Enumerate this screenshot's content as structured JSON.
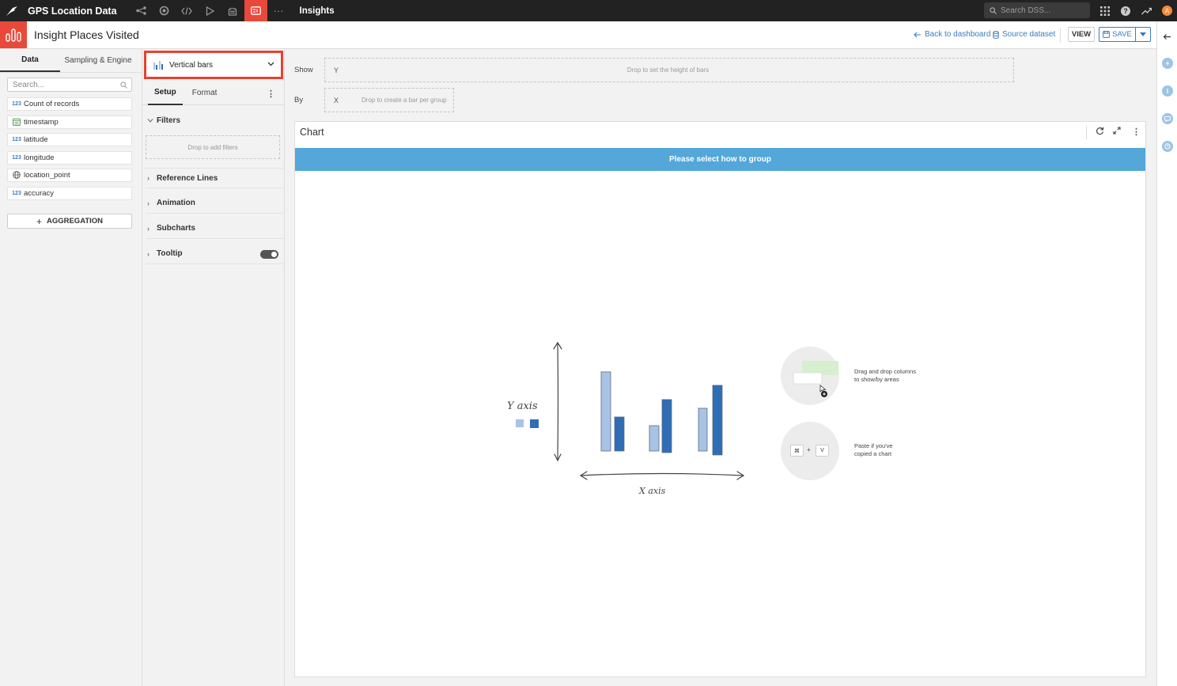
{
  "topbar": {
    "project": "GPS Location Data",
    "section": "Insights",
    "search_placeholder": "Search DSS..."
  },
  "header": {
    "title": "Insight Places Visited",
    "back_link": "Back to dashboard",
    "source_link": "Source dataset",
    "view_label": "VIEW",
    "save_label": "SAVE"
  },
  "left_panel": {
    "tabs": [
      "Data",
      "Sampling & Engine"
    ],
    "search_placeholder": "Search...",
    "columns": [
      {
        "type_icon": "123",
        "name": "Count of records"
      },
      {
        "type_icon": "calendar-icon",
        "name": "timestamp"
      },
      {
        "type_icon": "123",
        "name": "latitude"
      },
      {
        "type_icon": "123",
        "name": "longitude"
      },
      {
        "type_icon": "globe-icon",
        "name": "location_point"
      },
      {
        "type_icon": "123",
        "name": "accuracy"
      }
    ],
    "aggregation_label": "AGGREGATION"
  },
  "chart_config": {
    "chart_type": "Vertical bars",
    "tabs": [
      "Setup",
      "Format"
    ],
    "sections": {
      "filters": "Filters",
      "filters_drop": "Drop to add filters",
      "reference_lines": "Reference Lines",
      "animation": "Animation",
      "subcharts": "Subcharts",
      "tooltip": "Tooltip"
    },
    "tooltip_enabled": true
  },
  "dropzones": {
    "show_label": "Show",
    "by_label": "By",
    "y_axis": "Y",
    "y_hint": "Drop to set the height of bars",
    "x_axis": "X",
    "x_hint": "Drop to create a bar per group"
  },
  "chart_panel": {
    "title": "Chart",
    "banner": "Please select how to group",
    "illustration": {
      "y_axis_label": "Y axis",
      "x_axis_label": "X axis"
    },
    "hint_drag": "Drag and drop columns\nto show/by areas",
    "hint_paste": "Paste if you've\ncopied a chart",
    "key_cmd": "⌘",
    "key_plus": "+",
    "key_v": "V"
  },
  "colors": {
    "accent": "#e8493a",
    "link": "#3a7bbf",
    "banner": "#53a7d9",
    "bar_light": "#a9c3e6",
    "bar_dark": "#2f6db5"
  }
}
